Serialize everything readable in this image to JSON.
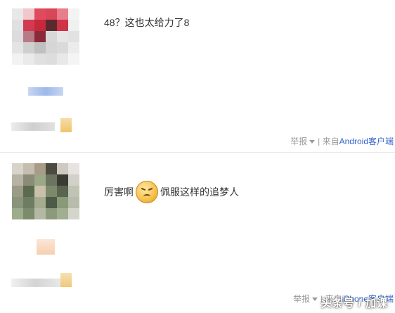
{
  "posts": [
    {
      "text": "48？这也太给力了8",
      "report_label": "举报",
      "separator": "|",
      "source_prefix": "来自",
      "source_client": "Android客户端"
    },
    {
      "text_before": "厉害啊",
      "emoji_icon": "smug-face-emoji",
      "text_after": "佩服这样的追梦人",
      "report_label": "举报",
      "separator": "|",
      "source_prefix": "来自",
      "source_client": "iPhone客户端"
    }
  ],
  "watermark": "头条号 / 加课",
  "colors": {
    "link": "#3366cc",
    "muted": "#999999",
    "divider": "#e6e6e6"
  }
}
